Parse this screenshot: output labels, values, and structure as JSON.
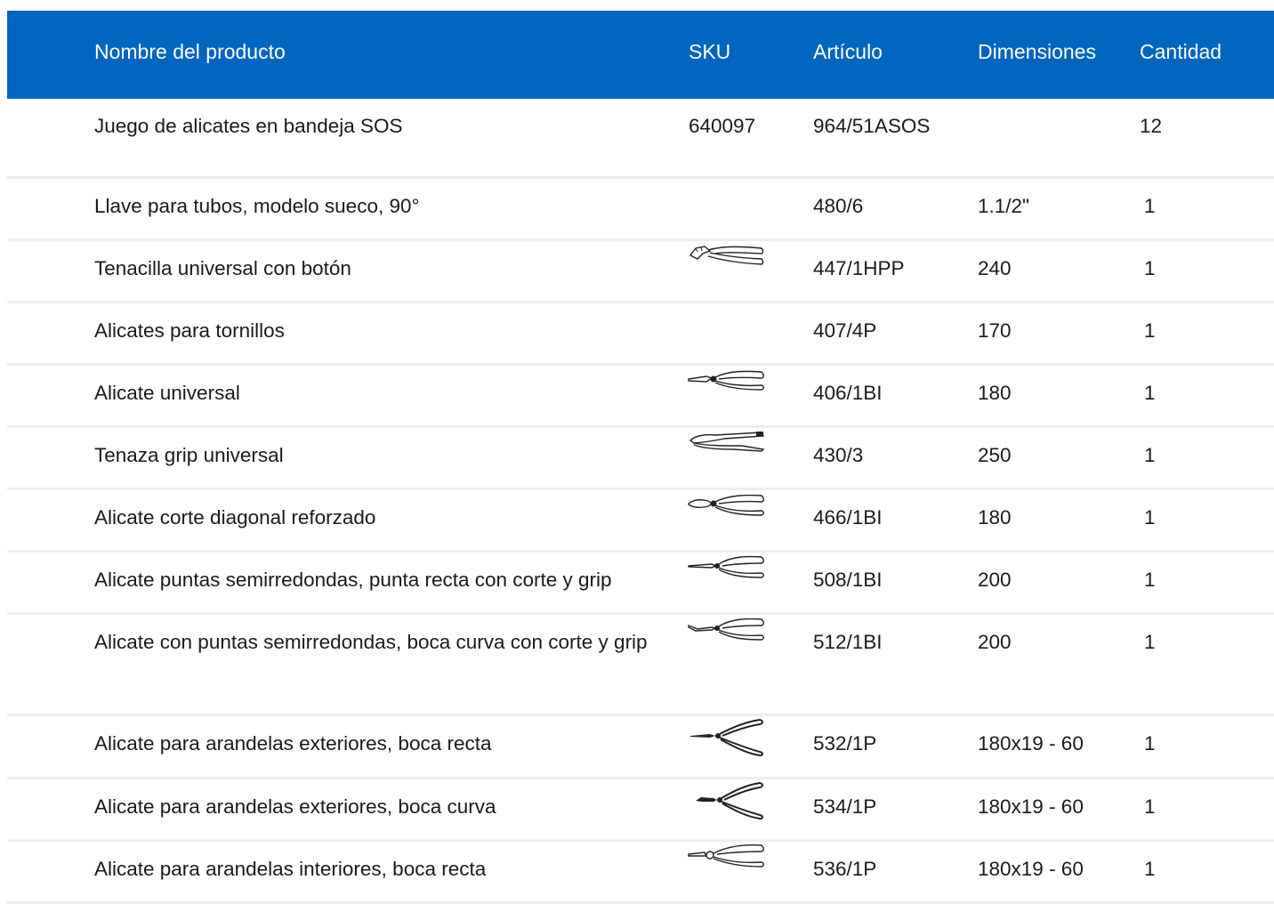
{
  "header": {
    "name": "Nombre del producto",
    "sku": "SKU",
    "article": "Artículo",
    "dimensions": "Dimensiones",
    "quantity": "Cantidad"
  },
  "colors": {
    "header_bg": "#0066bf",
    "header_text": "#ffffff",
    "row_divider": "#eceef0"
  },
  "rows": [
    {
      "name": "Juego de alicates en bandeja SOS",
      "sku": "640097",
      "icon": "",
      "article": "964/51ASOS",
      "dimensions": "",
      "quantity": "12"
    },
    {
      "name": "Llave para tubos, modelo sueco, 90°",
      "sku": "",
      "icon": "",
      "article": "480/6",
      "dimensions": "1.1/2\"",
      "quantity": "1"
    },
    {
      "name": "Tenacilla universal con botón",
      "sku": "",
      "icon": "water-pump-pliers-icon",
      "article": "447/1HPP",
      "dimensions": "240",
      "quantity": "1"
    },
    {
      "name": "Alicates para tornillos",
      "sku": "",
      "icon": "",
      "article": "407/4P",
      "dimensions": "170",
      "quantity": "1"
    },
    {
      "name": "Alicate universal",
      "sku": "",
      "icon": "combination-pliers-icon",
      "article": "406/1BI",
      "dimensions": "180",
      "quantity": "1"
    },
    {
      "name": "Tenaza grip universal",
      "sku": "",
      "icon": "locking-pliers-icon",
      "article": "430/3",
      "dimensions": "250",
      "quantity": "1"
    },
    {
      "name": "Alicate corte diagonal reforzado",
      "sku": "",
      "icon": "diagonal-cutter-icon",
      "article": "466/1BI",
      "dimensions": "180",
      "quantity": "1"
    },
    {
      "name": "Alicate puntas semirredondas, punta recta con corte y grip",
      "sku": "",
      "icon": "needle-nose-pliers-icon",
      "article": "508/1BI",
      "dimensions": "200",
      "quantity": "1"
    },
    {
      "name": "Alicate con puntas semirredondas, boca curva con corte y grip",
      "sku": "",
      "icon": "bent-nose-pliers-icon",
      "article": "512/1BI",
      "dimensions": "200",
      "quantity": "1"
    },
    {
      "name": "Alicate para arandelas exteriores, boca recta",
      "sku": "",
      "icon": "external-circlip-pliers-straight-icon",
      "article": "532/1P",
      "dimensions": "180x19 - 60",
      "quantity": "1"
    },
    {
      "name": "Alicate para arandelas exteriores, boca curva",
      "sku": "",
      "icon": "external-circlip-pliers-bent-icon",
      "article": "534/1P",
      "dimensions": "180x19 - 60",
      "quantity": "1"
    },
    {
      "name": "Alicate para arandelas interiores, boca recta",
      "sku": "",
      "icon": "internal-circlip-pliers-icon",
      "article": "536/1P",
      "dimensions": "180x19 - 60",
      "quantity": "1"
    }
  ]
}
